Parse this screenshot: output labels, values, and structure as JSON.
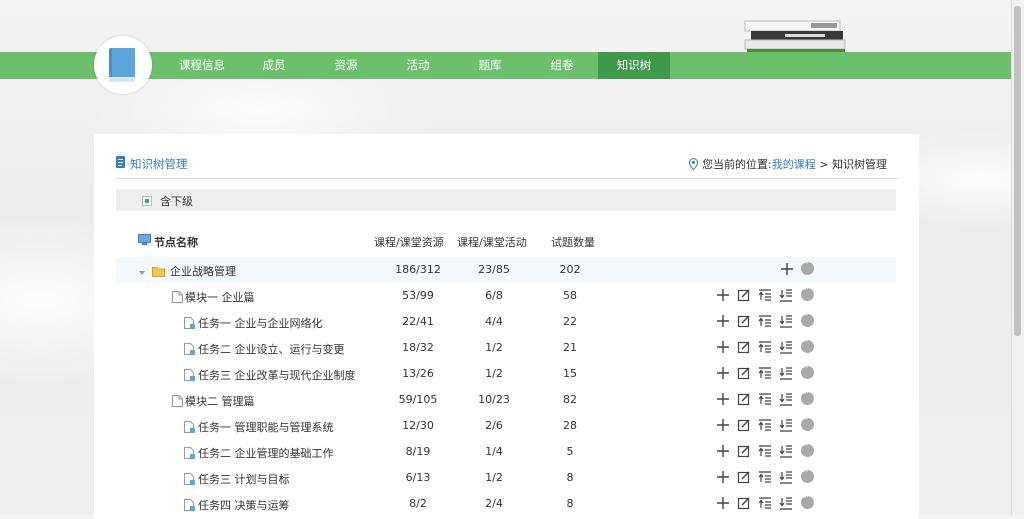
{
  "nav": {
    "items": [
      "课程信息",
      "成员",
      "资源",
      "活动",
      "题库",
      "组卷",
      "知识树"
    ],
    "active_index": 6
  },
  "breadcrumb": {
    "title": "知识树管理",
    "location_prefix": "您当前的位置:",
    "link": "我的课程",
    "separator": " > ",
    "current": "知识树管理"
  },
  "filter": {
    "label": "含下级",
    "checked": true
  },
  "table": {
    "headers": {
      "name": "节点名称",
      "resources": "课程/课堂资源",
      "activities": "课程/课堂活动",
      "questions": "试题数量"
    },
    "rows": [
      {
        "name": "企业战略管理",
        "level": 0,
        "resources": "186/312",
        "activities": "23/85",
        "questions": "202"
      },
      {
        "name": "模块一 企业篇",
        "level": 1,
        "resources": "53/99",
        "activities": "6/8",
        "questions": "58"
      },
      {
        "name": "任务一 企业与企业网络化",
        "level": 2,
        "resources": "22/41",
        "activities": "4/4",
        "questions": "22"
      },
      {
        "name": "任务二 企业设立、运行与变更",
        "level": 2,
        "resources": "18/32",
        "activities": "1/2",
        "questions": "21"
      },
      {
        "name": "任务三 企业改革与现代企业制度",
        "level": 2,
        "resources": "13/26",
        "activities": "1/2",
        "questions": "15"
      },
      {
        "name": "模块二 管理篇",
        "level": 1,
        "resources": "59/105",
        "activities": "10/23",
        "questions": "82"
      },
      {
        "name": "任务一 管理职能与管理系统",
        "level": 2,
        "resources": "12/30",
        "activities": "2/6",
        "questions": "28"
      },
      {
        "name": "任务二 企业管理的基础工作",
        "level": 2,
        "resources": "8/19",
        "activities": "1/4",
        "questions": "5"
      },
      {
        "name": "任务三 计划与目标",
        "level": 2,
        "resources": "6/13",
        "activities": "1/2",
        "questions": "8"
      },
      {
        "name": "任务四 决策与运筹",
        "level": 2,
        "resources": "8/2",
        "activities": "2/4",
        "questions": "8"
      }
    ]
  },
  "colors": {
    "nav_bg": "#6cc06c",
    "nav_active": "#3e9a4a",
    "link": "#2f7fb8"
  }
}
